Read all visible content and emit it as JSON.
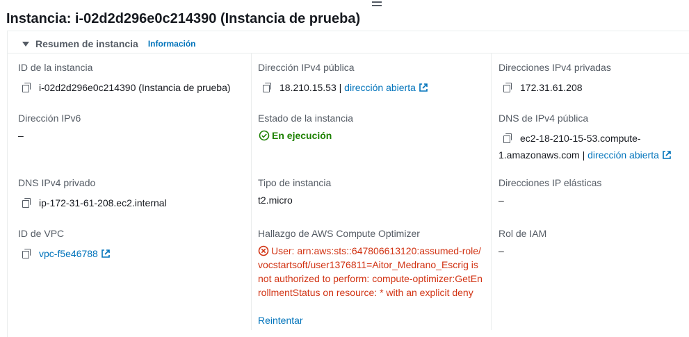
{
  "header": {
    "title": "Instancia: i-02d2d296e0c214390 (Instancia de prueba)"
  },
  "summary": {
    "title": "Resumen de instancia",
    "info_link": "Información"
  },
  "col1": {
    "instance_id_label": "ID de la instancia",
    "instance_id_value": "i-02d2d296e0c214390 (Instancia de prueba)",
    "ipv6_label": "Dirección IPv6",
    "ipv6_value": "–",
    "private_dns_label": "DNS IPv4 privado",
    "private_dns_value": "ip-172-31-61-208.ec2.internal",
    "vpc_label": "ID de VPC",
    "vpc_value": "vpc-f5e46788"
  },
  "col2": {
    "public_ip_label": "Dirección IPv4 pública",
    "public_ip_value": "18.210.15.53",
    "separator": "|",
    "open_address_link": "dirección abierta",
    "state_label": "Estado de la instancia",
    "state_value": "En ejecución",
    "type_label": "Tipo de instancia",
    "type_value": "t2.micro",
    "optimizer_label": "Hallazgo de AWS Compute Optimizer",
    "optimizer_error": "User: arn:aws:sts::647806613120:assumed-role/vocstartsoft/user1376811=Aitor_Medrano_Escrig is not authorized to perform: compute-optimizer:GetEnrollmentStatus on resource: * with an explicit deny",
    "retry_link": "Reintentar"
  },
  "col3": {
    "private_ips_label": "Direcciones IPv4 privadas",
    "private_ips_value": "172.31.61.208",
    "public_dns_label": "DNS de IPv4 pública",
    "public_dns_value_line1": "ec2-18-210-15-53.compute-",
    "public_dns_value_line2": "1.amazonaws.com",
    "separator": "|",
    "open_address_link": "dirección abierta",
    "elastic_ips_label": "Direcciones IP elásticas",
    "elastic_ips_value": "–",
    "iam_role_label": "Rol de IAM",
    "iam_role_value": "–"
  },
  "colors": {
    "link": "#0073bb",
    "success": "#1d8102",
    "error": "#d13212",
    "label": "#545b64"
  },
  "icons": [
    "drag-handle-icon",
    "caret-down-icon",
    "copy-icon",
    "external-link-icon",
    "check-circle-icon",
    "error-circle-icon"
  ]
}
